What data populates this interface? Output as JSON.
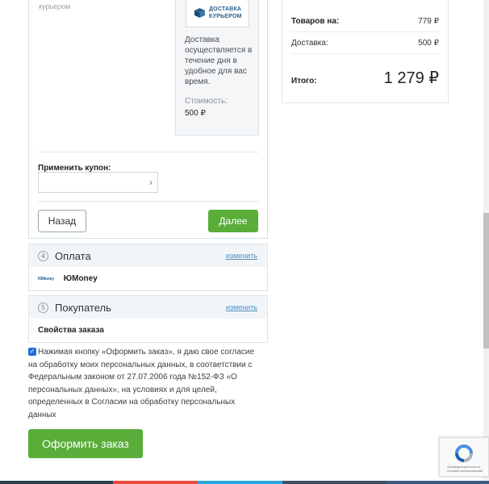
{
  "delivery": {
    "courier_subtitle": "курьером",
    "logo_text_1": "ДОСТАВКА",
    "logo_text_2": "КУРЬЕРОМ",
    "description": "Доставка осуществляется в течение дня в удобное для вас время.",
    "cost_label": "Стоимость:",
    "cost_value": "500 ₽",
    "coupon_label": "Применить купон:",
    "coupon_value": "",
    "back_label": "Назад",
    "next_label": "Далее"
  },
  "steps": [
    {
      "number": "4",
      "title": "Оплата",
      "edit_label": "изменить",
      "body_label": "ЮMoney",
      "logo_text": "ЮMoney"
    },
    {
      "number": "5",
      "title": "Покупатель",
      "edit_label": "изменить",
      "body_label": "Свойства заказа"
    }
  ],
  "consent": {
    "checked": true,
    "text": "Нажимая кнопку «Оформить заказ», я даю свое согласие на обработку моих персональных данных, в соответствии с Федеральным законом от 27.07.2006 года №152-ФЗ «О персональных данных», на условиях и для целей, определенных в Согласии на обработку персональных данных"
  },
  "order_button_label": "Оформить заказ",
  "summary": {
    "goods_label": "Товаров на:",
    "goods_value": "779 ₽",
    "delivery_label": "Доставка:",
    "delivery_value": "500 ₽",
    "total_label": "Итого:",
    "total_value": "1 279 ₽"
  },
  "recaptcha": {
    "text": "Конфиденциальность - Условия использования"
  },
  "colors": {
    "accent_green": "#5aad39",
    "link_blue": "#4e90c2",
    "strip": [
      "#2c3e50",
      "#3d4f63",
      "#e74c3c",
      "#34495e",
      "#2aa8e0",
      "#3d5a80"
    ]
  }
}
